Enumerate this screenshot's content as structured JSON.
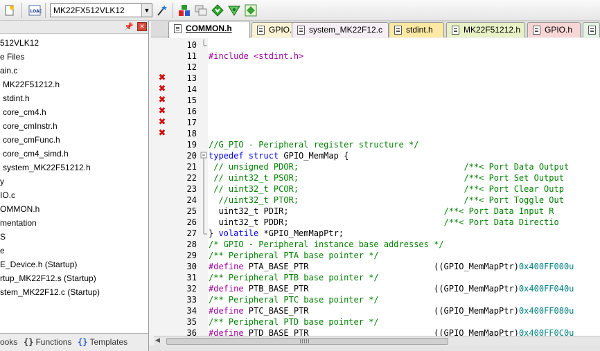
{
  "toolbar": {
    "target_value": "MK22FX512VLK12",
    "icons": [
      "new-file-icon",
      "load-icon",
      "options-wand-icon",
      "manage-components-icon",
      "windows-icon",
      "download-icon",
      "debug-icon",
      "pack-installer-icon"
    ]
  },
  "project_panel": {
    "tree": [
      {
        "label": "512VLK12"
      },
      {
        "label": "e Files"
      },
      {
        "label": "ain.c"
      },
      {
        "label": "MK22F51212.h"
      },
      {
        "label": "stdint.h"
      },
      {
        "label": "core_cm4.h"
      },
      {
        "label": "core_cmInstr.h"
      },
      {
        "label": "core_cmFunc.h"
      },
      {
        "label": "core_cm4_simd.h"
      },
      {
        "label": "system_MK22F51212.h"
      },
      {
        "label": "y"
      },
      {
        "label": "IO.c"
      },
      {
        "label": "OMMON.h"
      },
      {
        "label": "mentation"
      },
      {
        "label": "S"
      },
      {
        "label": "e"
      },
      {
        "label": "E_Device.h (Startup)"
      },
      {
        "label": "rtup_MK22F12.s (Startup)"
      },
      {
        "label": "stem_MK22F12.c (Startup)"
      }
    ],
    "bottom_tabs": [
      {
        "icon": "",
        "label": "ooks"
      },
      {
        "icon": "{}",
        "label": "Functions"
      },
      {
        "icon": "{}",
        "label": "Templates"
      }
    ]
  },
  "file_tabs": [
    {
      "label": "COMMON.h",
      "active": true,
      "color": "#ffffff"
    },
    {
      "label": "GPIO.c",
      "active": false,
      "color": "#f9f3d4"
    },
    {
      "label": "system_MK22F12.c",
      "active": false,
      "color": "#f5eef5"
    },
    {
      "label": "stdint.h",
      "active": false,
      "color": "#fde9a3"
    },
    {
      "label": "MK22F51212.h",
      "active": false,
      "color": "#e8f0c6"
    },
    {
      "label": "GPIO.h",
      "active": false,
      "color": "#f8d6d6"
    },
    {
      "label": "",
      "active": false,
      "color": "#e4f3e4"
    }
  ],
  "editor": {
    "lines": [
      {
        "n": "10",
        "err": false,
        "segs": [
          {
            "t": "",
            "c": ""
          }
        ]
      },
      {
        "n": "11",
        "err": false,
        "segs": [
          {
            "t": "#include ",
            "c": "pp"
          },
          {
            "t": "<stdint.h>",
            "c": "str"
          }
        ]
      },
      {
        "n": "12",
        "err": false,
        "segs": [
          {
            "t": "",
            "c": ""
          }
        ]
      },
      {
        "n": "13",
        "err": true,
        "segs": [
          {
            "t": "",
            "c": ""
          }
        ]
      },
      {
        "n": "14",
        "err": true,
        "segs": [
          {
            "t": "",
            "c": ""
          }
        ]
      },
      {
        "n": "15",
        "err": true,
        "segs": [
          {
            "t": "",
            "c": ""
          }
        ]
      },
      {
        "n": "16",
        "err": true,
        "segs": [
          {
            "t": "",
            "c": ""
          }
        ]
      },
      {
        "n": "17",
        "err": true,
        "segs": [
          {
            "t": "",
            "c": ""
          }
        ]
      },
      {
        "n": "18",
        "err": true,
        "segs": [
          {
            "t": "",
            "c": ""
          }
        ]
      },
      {
        "n": "19",
        "err": false,
        "segs": [
          {
            "t": "//G_PIO - Peripheral register structure */",
            "c": "cm"
          }
        ]
      },
      {
        "n": "20",
        "err": false,
        "segs": [
          {
            "t": "typedef struct ",
            "c": "kw"
          },
          {
            "t": "GPIO_MemMap {",
            "c": ""
          }
        ]
      },
      {
        "n": "21",
        "err": false,
        "segs": [
          {
            "t": " // unsigned PDOR;                                 /**< Port Data Output",
            "c": "cm"
          }
        ]
      },
      {
        "n": "22",
        "err": false,
        "segs": [
          {
            "t": " // uint32_t PSOR;                                 /**< Port Set Output",
            "c": "cm"
          }
        ]
      },
      {
        "n": "23",
        "err": false,
        "segs": [
          {
            "t": " // uint32_t PCOR;                                 /**< Port Clear Outp",
            "c": "cm"
          }
        ]
      },
      {
        "n": "24",
        "err": false,
        "segs": [
          {
            "t": "  //uint32_t PTOR;                                 /**< Port Toggle Out",
            "c": "cm"
          }
        ]
      },
      {
        "n": "25",
        "err": false,
        "segs": [
          {
            "t": "  uint32_t PDIR;                               ",
            "c": ""
          },
          {
            "t": "/**< Port Data Input R",
            "c": "cm"
          }
        ]
      },
      {
        "n": "26",
        "err": false,
        "segs": [
          {
            "t": "  uint32_t PDDR;                               ",
            "c": ""
          },
          {
            "t": "/**< Port Data Directio",
            "c": "cm"
          }
        ]
      },
      {
        "n": "27",
        "err": false,
        "segs": [
          {
            "t": "} ",
            "c": ""
          },
          {
            "t": "volatile ",
            "c": "kw"
          },
          {
            "t": "*GPIO_MemMapPtr;",
            "c": ""
          }
        ]
      },
      {
        "n": "28",
        "err": false,
        "segs": [
          {
            "t": "/* GPIO - Peripheral instance base addresses */",
            "c": "cm"
          }
        ]
      },
      {
        "n": "29",
        "err": false,
        "segs": [
          {
            "t": "/** Peripheral PTA base pointer */",
            "c": "cm"
          }
        ]
      },
      {
        "n": "30",
        "err": false,
        "segs": [
          {
            "t": "#define ",
            "c": "pp"
          },
          {
            "t": "PTA_BASE_PTR                         ((GPIO_MemMapPtr)",
            "c": ""
          },
          {
            "t": "0x400FF000u",
            "c": "hx"
          }
        ]
      },
      {
        "n": "31",
        "err": false,
        "segs": [
          {
            "t": "/** Peripheral PTB base pointer */",
            "c": "cm"
          }
        ]
      },
      {
        "n": "32",
        "err": false,
        "segs": [
          {
            "t": "#define ",
            "c": "pp"
          },
          {
            "t": "PTB_BASE_PTR                         ((GPIO_MemMapPtr)",
            "c": ""
          },
          {
            "t": "0x400FF040u",
            "c": "hx"
          }
        ]
      },
      {
        "n": "33",
        "err": false,
        "segs": [
          {
            "t": "/** Peripheral PTC base pointer */",
            "c": "cm"
          }
        ]
      },
      {
        "n": "34",
        "err": false,
        "segs": [
          {
            "t": "#define ",
            "c": "pp"
          },
          {
            "t": "PTC_BASE_PTR                         ((GPIO_MemMapPtr)",
            "c": ""
          },
          {
            "t": "0x400FF080u",
            "c": "hx"
          }
        ]
      },
      {
        "n": "35",
        "err": false,
        "segs": [
          {
            "t": "/** Peripheral PTD base pointer */",
            "c": "cm"
          }
        ]
      },
      {
        "n": "36",
        "err": false,
        "segs": [
          {
            "t": "#define ",
            "c": "pp"
          },
          {
            "t": "PTD_BASE_PTR                         ((GPIO_MemMapPtr)",
            "c": ""
          },
          {
            "t": "0x400FF0C0u",
            "c": "hx"
          }
        ]
      }
    ]
  },
  "colors": {
    "error_marker": "#d60000",
    "keyword": "#0000ff",
    "comment": "#008000",
    "preprocessor": "#a000a0",
    "hex_number": "#008080"
  }
}
